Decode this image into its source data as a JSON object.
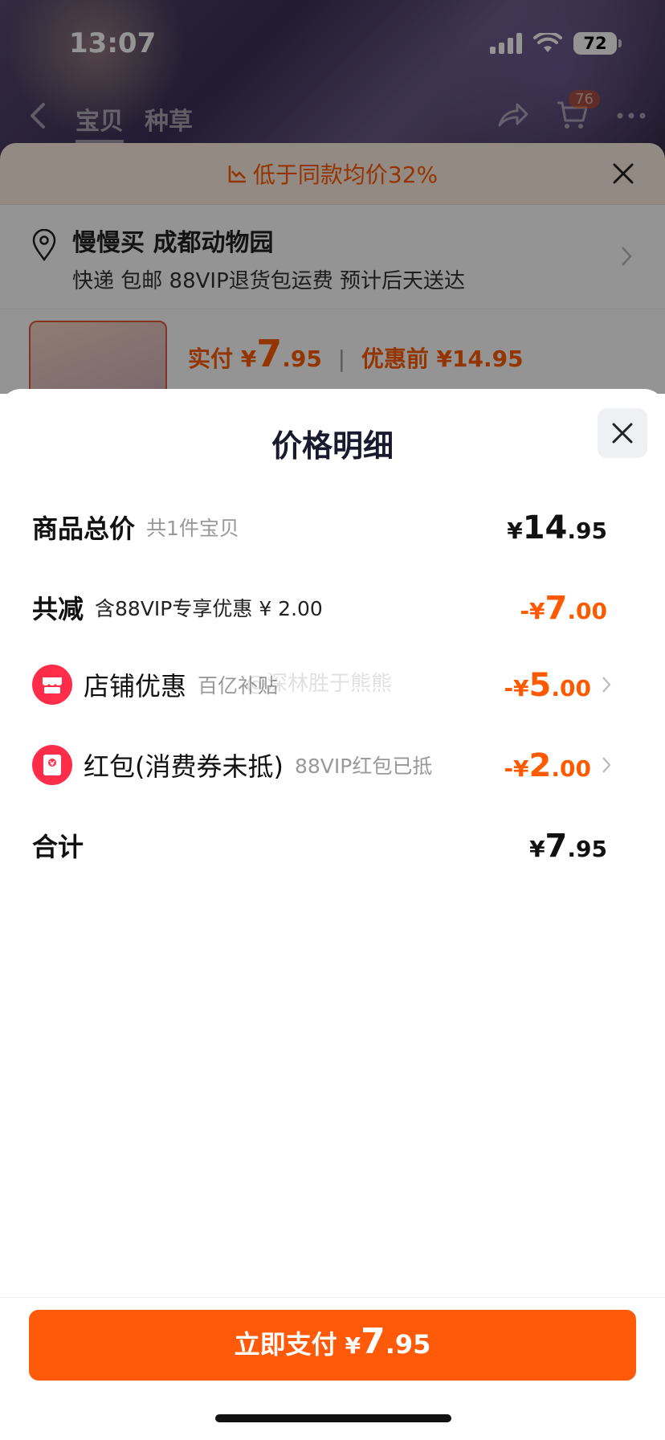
{
  "status_bar": {
    "time": "13:07",
    "battery": "72"
  },
  "nav": {
    "tabs": [
      "宝贝",
      "种草"
    ],
    "cart_badge": "76"
  },
  "background": {
    "banner_text": "低于同款均价32%",
    "address_line1": "慢慢买 成都动物园",
    "address_line2": "快递 包邮 88VIP退货包运费 预计后天送达",
    "price_label": "实付",
    "price_currency": "¥",
    "price_int": "7",
    "price_dec": ".95",
    "price_before": "优惠前 ¥14.95"
  },
  "sheet": {
    "title": "价格明细",
    "rows": [
      {
        "label": "商品总价",
        "sub": "共1件宝贝",
        "value_cur": "¥",
        "value_int": "14",
        "value_dec": ".95"
      },
      {
        "label": "共减",
        "sub": "含88VIP专享优惠 ¥ 2.00",
        "value_cur": "-¥",
        "value_int": "7",
        "value_dec": ".00"
      },
      {
        "label": "店铺优惠",
        "sub": "百亿补贴",
        "value_cur": "-¥",
        "value_int": "5",
        "value_dec": ".00"
      },
      {
        "label": "红包(消费券未抵)",
        "sub": "88VIP红包已抵",
        "value_cur": "-¥",
        "value_int": "2",
        "value_dec": ".00"
      },
      {
        "label": "合计",
        "sub": "",
        "value_cur": "¥",
        "value_int": "7",
        "value_dec": ".95"
      }
    ],
    "watermark": "@深林胜于熊熊",
    "pay_button": {
      "label": "立即支付",
      "cur": "¥",
      "int": "7",
      "dec": ".95"
    }
  },
  "colors": {
    "accent": "#ff5a0a",
    "discount": "#ff5a00",
    "badge_red": "#ff2d4a"
  }
}
